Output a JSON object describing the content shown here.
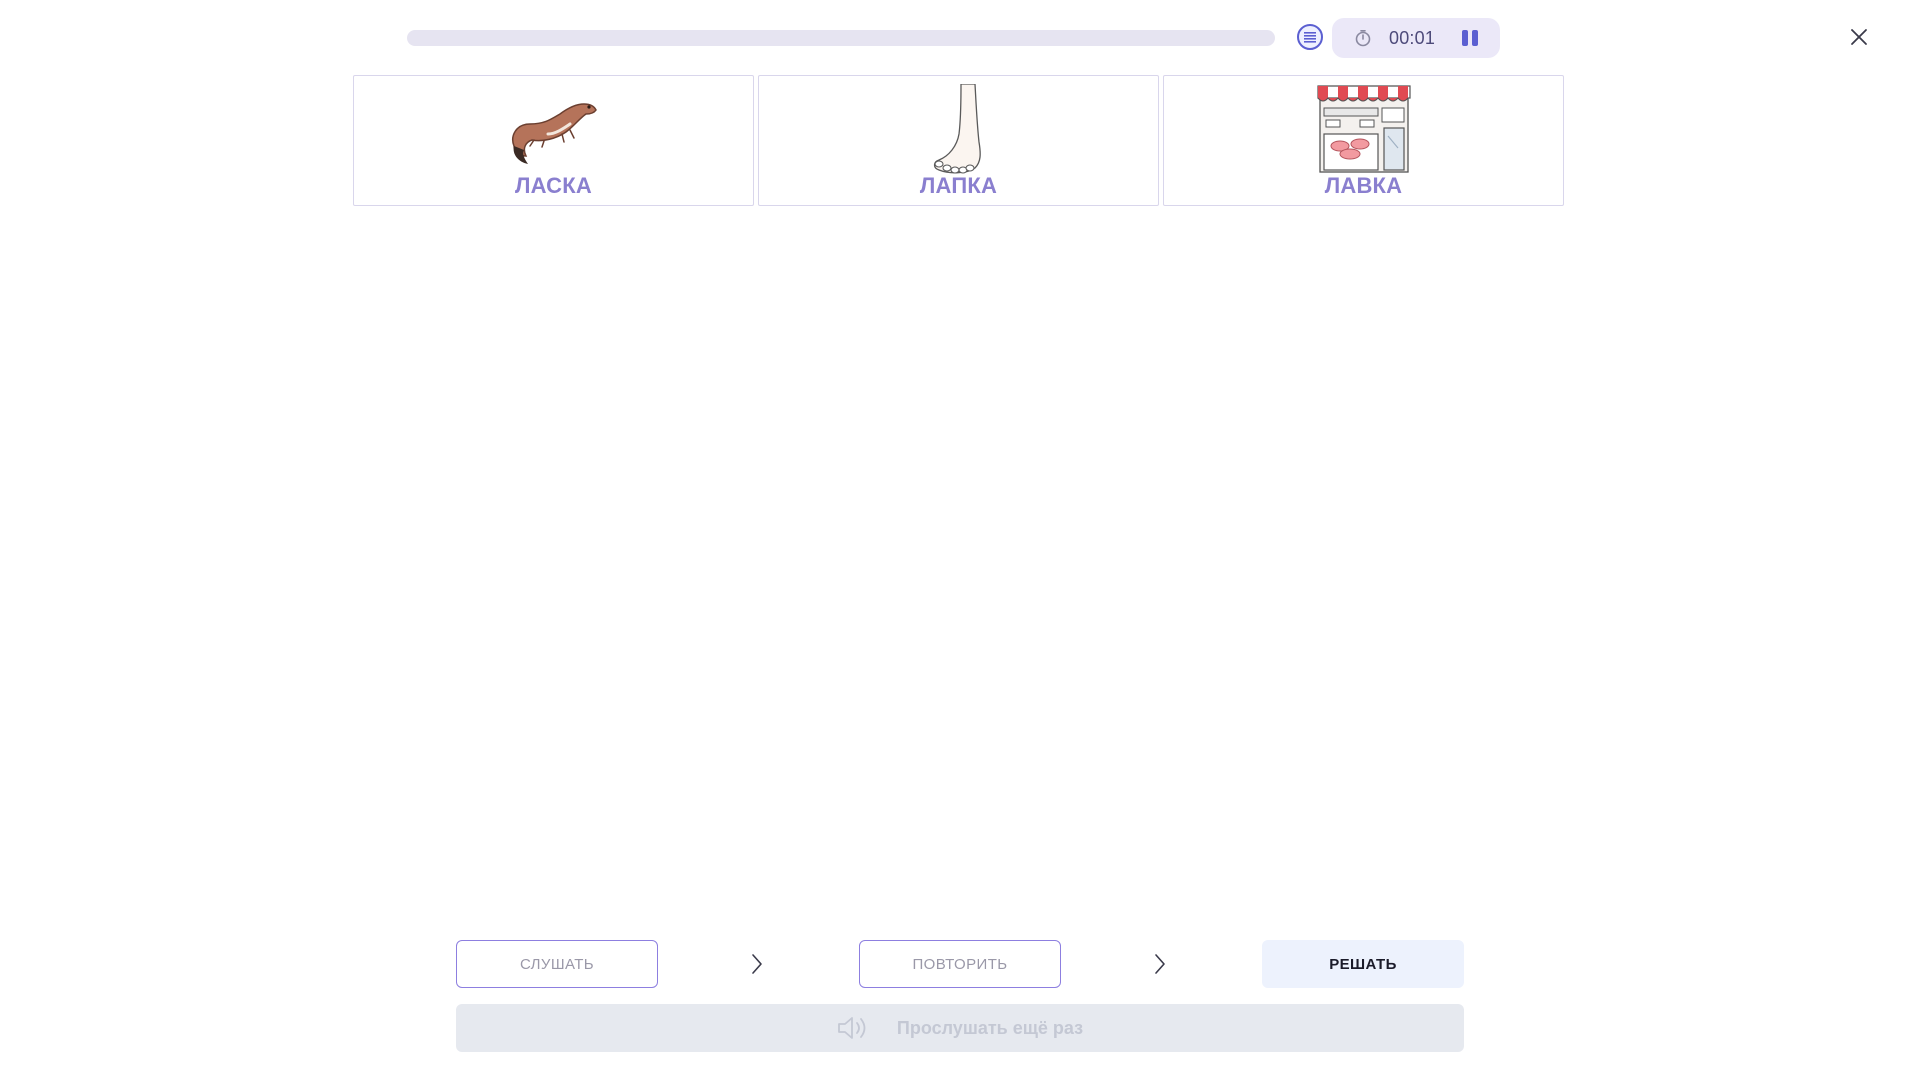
{
  "header": {
    "progress_fraction": 0.0,
    "timer": "00:01",
    "icons": {
      "list": "list-icon",
      "timer": "stopwatch-icon",
      "pause": "pause-icon",
      "close": "close-icon"
    }
  },
  "cards": [
    {
      "label": "ЛАСКА",
      "icon": "weasel-icon"
    },
    {
      "label": "ЛАПКА",
      "icon": "foot-icon"
    },
    {
      "label": "ЛАВКА",
      "icon": "shop-icon"
    }
  ],
  "steps": {
    "listen_label": "СЛУШАТЬ",
    "repeat_label": "ПОВТОРИТЬ",
    "solve_label": "РЕШАТЬ"
  },
  "replay": {
    "label": "Прослушать ещё раз",
    "icon": "speaker-icon"
  },
  "colors": {
    "accent": "#5b5fd1",
    "card_label": "#8a7fcf",
    "step_border": "#8d7fe0",
    "active_step_bg": "#edf2fd",
    "disabled_bg": "#e6e9ef"
  }
}
